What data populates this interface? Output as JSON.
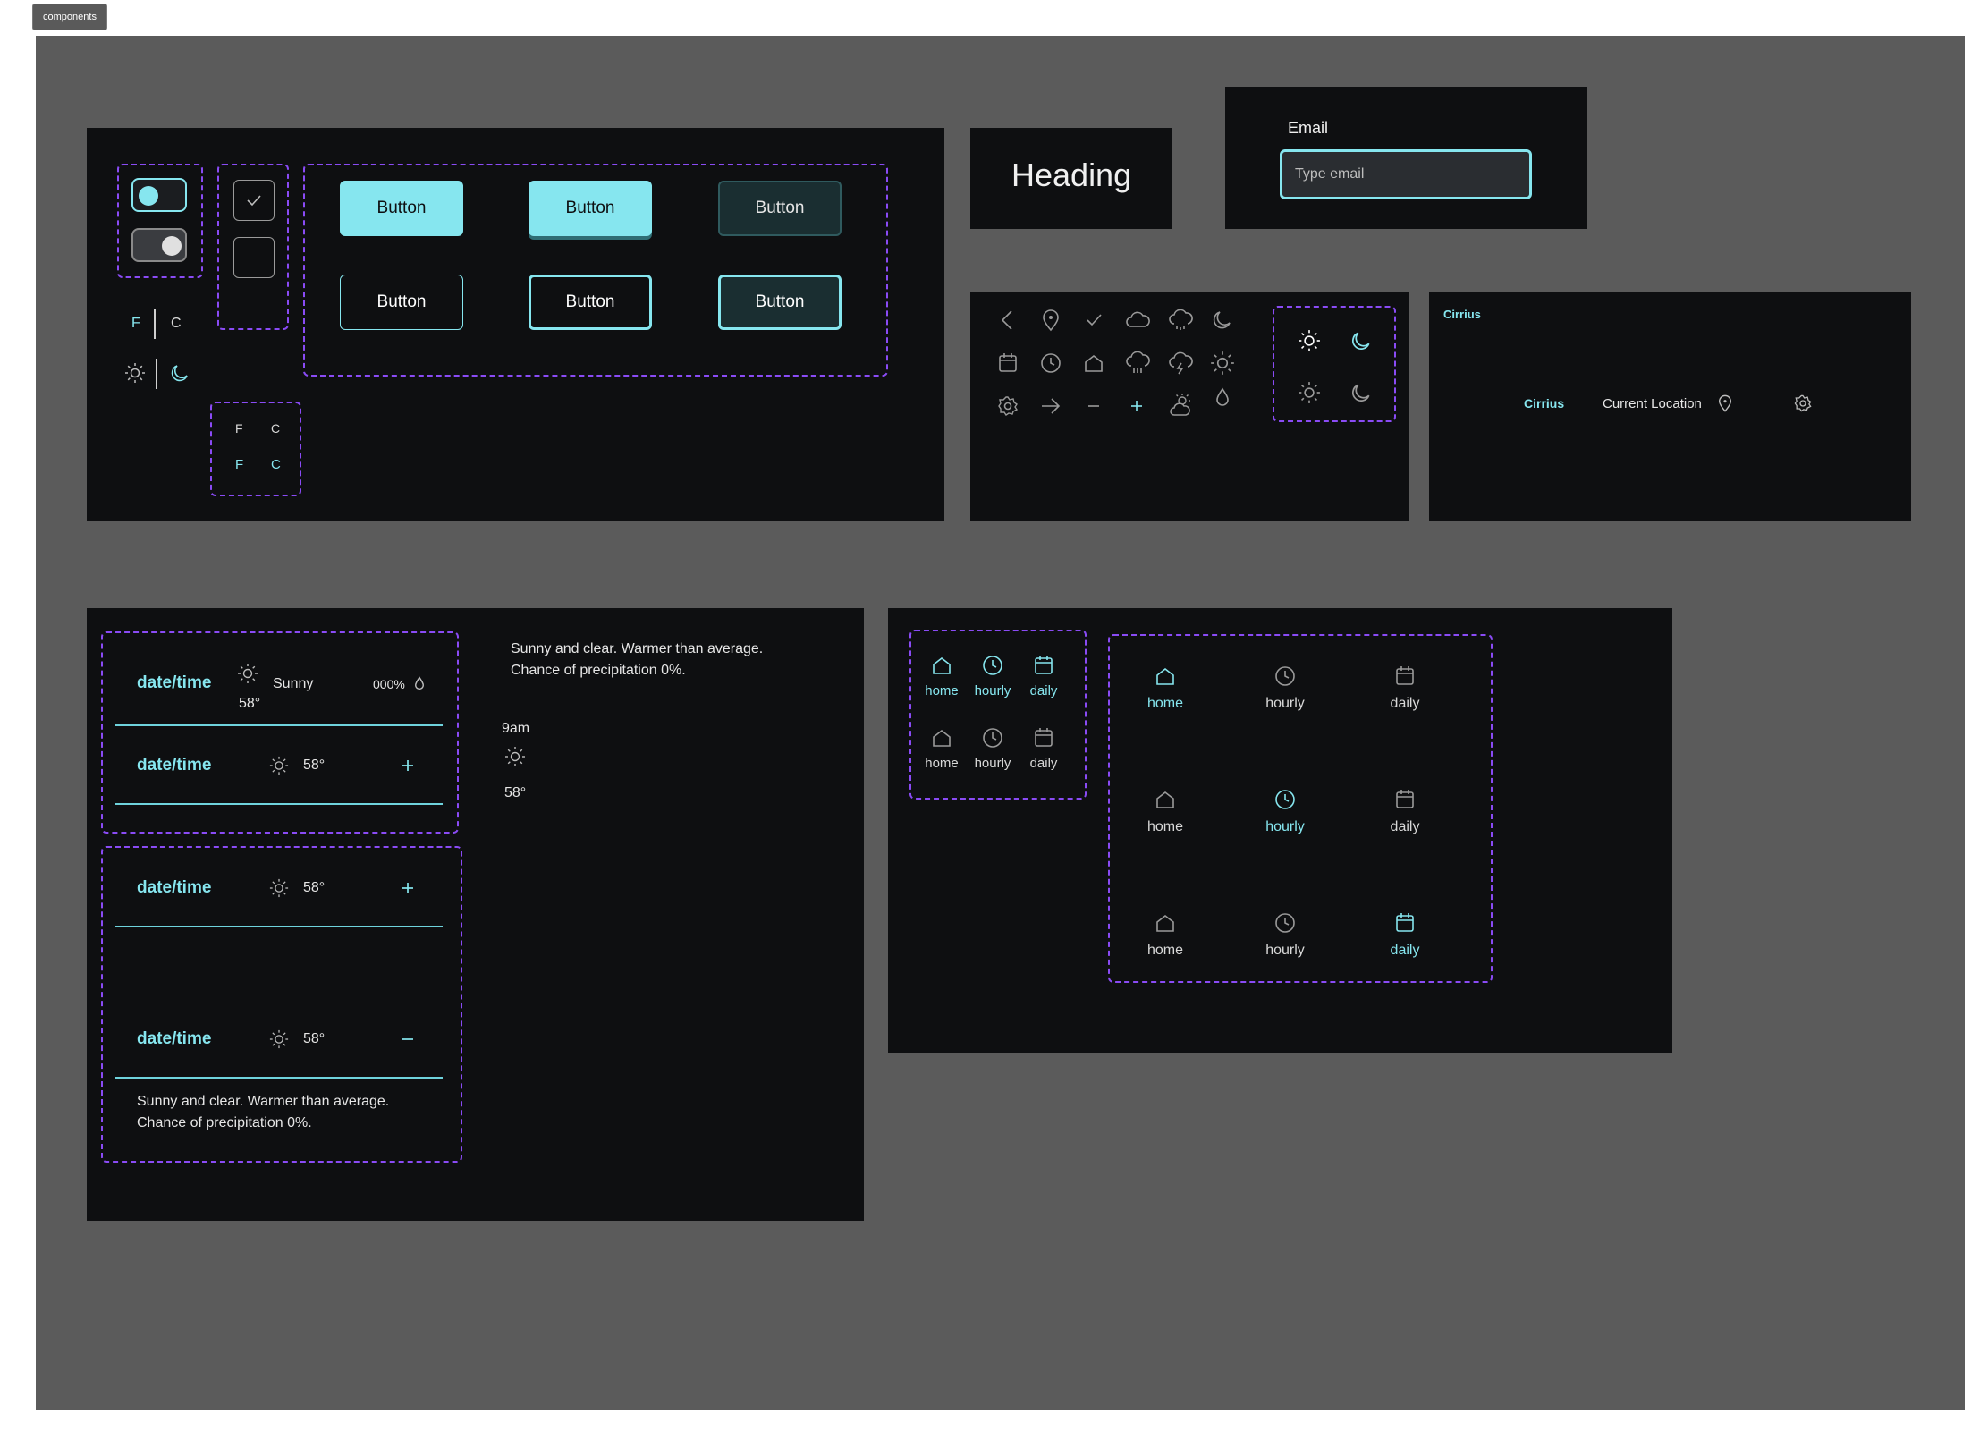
{
  "frame": {
    "tag": "components"
  },
  "controls": {
    "unit_f": "F",
    "unit_c": "C",
    "units_small": [
      {
        "f": "F",
        "c": "C"
      },
      {
        "f": "F",
        "c": "C"
      }
    ],
    "buttons": [
      "Button",
      "Button",
      "Button",
      "Button",
      "Button",
      "Button"
    ]
  },
  "heading": {
    "text": "Heading"
  },
  "email": {
    "label": "Email",
    "placeholder": "Type email"
  },
  "icons": {
    "row1": [
      "chevron-left-icon",
      "map-pin-icon",
      "check-icon",
      "cloud-icon",
      "cloud-drizzle-icon",
      "moon-icon"
    ],
    "row2": [
      "calendar-icon",
      "clock-icon",
      "home-icon",
      "cloud-rain-icon",
      "cloud-lightning-icon",
      "sun-icon"
    ],
    "row3": [
      "settings-icon",
      "arrow-right-icon",
      "minus-icon",
      "plus-icon",
      "partly-cloudy-icon",
      "droplet-icon"
    ]
  },
  "header": {
    "brand_small": "Cirrius",
    "brand": "Cirrius",
    "location": "Current Location"
  },
  "forecast": {
    "card1": {
      "date": "date/time",
      "condition": "Sunny",
      "temp": "58°",
      "precip": "000%"
    },
    "card2": {
      "date": "date/time",
      "temp": "58°"
    },
    "card3": {
      "date": "date/time",
      "temp": "58°"
    },
    "card4": {
      "date": "date/time",
      "temp": "58°",
      "description": "Sunny and clear. Warmer than average. Chance of precipitation 0%."
    },
    "summary": "Sunny and clear. Warmer than average. Chance of precipitation 0%.",
    "hour": {
      "time": "9am",
      "temp": "58°"
    }
  },
  "nav": {
    "home": "home",
    "hourly": "hourly",
    "daily": "daily"
  },
  "colors": {
    "accent": "#86e6ef",
    "panel": "#0e0f11",
    "canvas": "#5b5b5b",
    "dash": "#8a4bf5"
  }
}
